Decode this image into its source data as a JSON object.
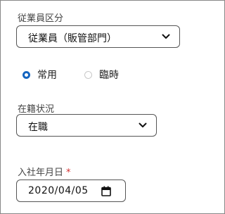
{
  "employment_type": {
    "label": "従業員区分",
    "selected": "従業員（販管部門）"
  },
  "employment_category": {
    "options": [
      {
        "label": "常用",
        "checked": true
      },
      {
        "label": "臨時",
        "checked": false
      }
    ]
  },
  "enrollment_status": {
    "label": "在籍状況",
    "selected": "在職"
  },
  "hire_date": {
    "label": "入社年月日",
    "required_mark": "*",
    "value": "2020/04/05"
  },
  "colors": {
    "accent": "#1565c0",
    "required": "#d32f2f",
    "border": "#555555"
  },
  "icons": {
    "select_arrow": "chevron-down-icon",
    "date_picker": "calendar-icon"
  }
}
